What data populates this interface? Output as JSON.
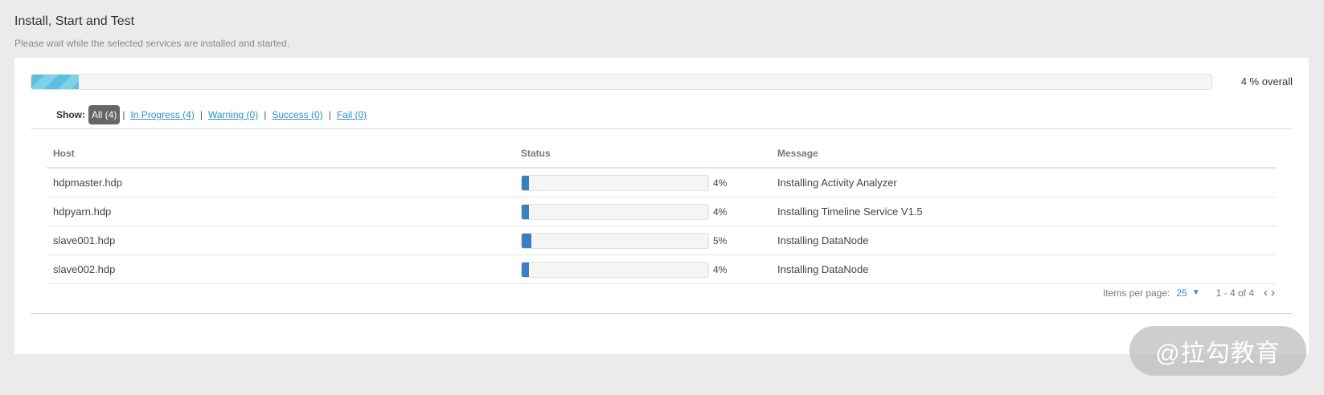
{
  "header": {
    "title": "Install, Start and Test",
    "subtitle": "Please wait while the selected services are installed and started."
  },
  "overall": {
    "percent": 4,
    "label": "4 % overall"
  },
  "filters": {
    "show_label": "Show:",
    "items": [
      {
        "label": "All (4)",
        "active": true
      },
      {
        "label": "In Progress (4)",
        "active": false
      },
      {
        "label": "Warning (0)",
        "active": false
      },
      {
        "label": "Success (0)",
        "active": false
      },
      {
        "label": "Fail (0)",
        "active": false
      }
    ],
    "separator": "|"
  },
  "table": {
    "columns": [
      "Host",
      "Status",
      "Message"
    ],
    "rows": [
      {
        "host": "hdpmaster.hdp",
        "percent": 4,
        "percent_label": "4%",
        "message": "Installing Activity Analyzer"
      },
      {
        "host": "hdpyarn.hdp",
        "percent": 4,
        "percent_label": "4%",
        "message": "Installing Timeline Service V1.5"
      },
      {
        "host": "slave001.hdp",
        "percent": 5,
        "percent_label": "5%",
        "message": "Installing DataNode"
      },
      {
        "host": "slave002.hdp",
        "percent": 4,
        "percent_label": "4%",
        "message": "Installing DataNode"
      }
    ]
  },
  "pagination": {
    "items_per_page_label": "Items per page:",
    "items_per_page": "25",
    "range": "1 - 4 of 4",
    "prev_icon": "chevron-left-icon",
    "next_icon": "chevron-right-icon"
  },
  "watermark": {
    "text": "@拉勾教育"
  },
  "colors": {
    "background": "#ebebeb",
    "overall_bar": "#5bc0de",
    "host_bar": "#3a7fc1",
    "link": "#2b8fca",
    "active_filter": "#666666"
  }
}
